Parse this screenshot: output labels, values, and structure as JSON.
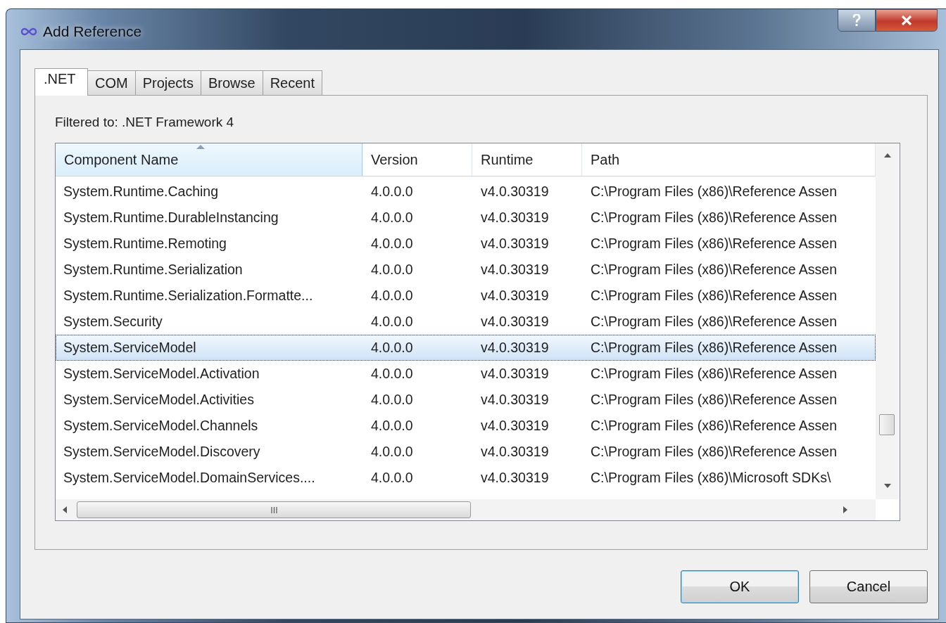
{
  "window": {
    "title": "Add Reference"
  },
  "tabs": [
    {
      "label": ".NET",
      "selected": true
    },
    {
      "label": "COM",
      "selected": false
    },
    {
      "label": "Projects",
      "selected": false
    },
    {
      "label": "Browse",
      "selected": false
    },
    {
      "label": "Recent",
      "selected": false
    }
  ],
  "filter_label": "Filtered to: .NET Framework 4",
  "table": {
    "columns": [
      {
        "label": "Component Name",
        "sorted": true
      },
      {
        "label": "Version",
        "sorted": false
      },
      {
        "label": "Runtime",
        "sorted": false
      },
      {
        "label": "Path",
        "sorted": false
      }
    ],
    "rows": [
      {
        "cells": [
          "System.Runtime.Caching",
          "4.0.0.0",
          "v4.0.30319",
          "C:\\Program Files (x86)\\Reference Assen"
        ],
        "selected": false
      },
      {
        "cells": [
          "System.Runtime.DurableInstancing",
          "4.0.0.0",
          "v4.0.30319",
          "C:\\Program Files (x86)\\Reference Assen"
        ],
        "selected": false
      },
      {
        "cells": [
          "System.Runtime.Remoting",
          "4.0.0.0",
          "v4.0.30319",
          "C:\\Program Files (x86)\\Reference Assen"
        ],
        "selected": false
      },
      {
        "cells": [
          "System.Runtime.Serialization",
          "4.0.0.0",
          "v4.0.30319",
          "C:\\Program Files (x86)\\Reference Assen"
        ],
        "selected": false
      },
      {
        "cells": [
          "System.Runtime.Serialization.Formatte...",
          "4.0.0.0",
          "v4.0.30319",
          "C:\\Program Files (x86)\\Reference Assen"
        ],
        "selected": false
      },
      {
        "cells": [
          "System.Security",
          "4.0.0.0",
          "v4.0.30319",
          "C:\\Program Files (x86)\\Reference Assen"
        ],
        "selected": false
      },
      {
        "cells": [
          "System.ServiceModel",
          "4.0.0.0",
          "v4.0.30319",
          "C:\\Program Files (x86)\\Reference Assen"
        ],
        "selected": true
      },
      {
        "cells": [
          "System.ServiceModel.Activation",
          "4.0.0.0",
          "v4.0.30319",
          "C:\\Program Files (x86)\\Reference Assen"
        ],
        "selected": false
      },
      {
        "cells": [
          "System.ServiceModel.Activities",
          "4.0.0.0",
          "v4.0.30319",
          "C:\\Program Files (x86)\\Reference Assen"
        ],
        "selected": false
      },
      {
        "cells": [
          "System.ServiceModel.Channels",
          "4.0.0.0",
          "v4.0.30319",
          "C:\\Program Files (x86)\\Reference Assen"
        ],
        "selected": false
      },
      {
        "cells": [
          "System.ServiceModel.Discovery",
          "4.0.0.0",
          "v4.0.30319",
          "C:\\Program Files (x86)\\Reference Assen"
        ],
        "selected": false
      },
      {
        "cells": [
          "System.ServiceModel.DomainServices....",
          "4.0.0.0",
          "v4.0.30319",
          "C:\\Program Files (x86)\\Microsoft SDKs\\"
        ],
        "selected": false
      }
    ]
  },
  "buttons": [
    {
      "label": "OK",
      "kind": "default"
    },
    {
      "label": "Cancel",
      "kind": "normal"
    }
  ]
}
